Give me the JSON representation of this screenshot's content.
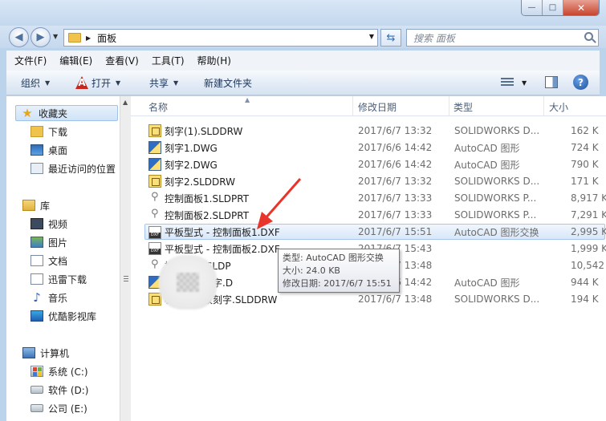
{
  "window": {
    "ghost_title": "",
    "buttons": {
      "minimize": "—",
      "maximize": "□",
      "close": "✕"
    }
  },
  "nav": {
    "address": "面板",
    "search_placeholder": "搜索 面板"
  },
  "menu": [
    "文件(F)",
    "编辑(E)",
    "查看(V)",
    "工具(T)",
    "帮助(H)"
  ],
  "toolbar": {
    "organize": "组织",
    "open": "打开",
    "share": "共享",
    "new_folder": "新建文件夹"
  },
  "sidebar": {
    "favorites": "收藏夹",
    "fav_items": [
      "下载",
      "桌面",
      "最近访问的位置"
    ],
    "libraries": "库",
    "lib_items": [
      "视频",
      "图片",
      "文档",
      "迅雷下载",
      "音乐",
      "优酷影视库"
    ],
    "computer": "计算机",
    "drives": [
      "系统 (C:)",
      "软件 (D:)",
      "公司 (E:)"
    ]
  },
  "columns": {
    "name": "名称",
    "date": "修改日期",
    "type": "类型",
    "size": "大小"
  },
  "files": [
    {
      "name": "刻字(1).SLDDRW",
      "date": "2017/6/7 13:32",
      "type": "SOLIDWORKS D...",
      "size": "162 K",
      "icon": "slddrw"
    },
    {
      "name": "刻字1.DWG",
      "date": "2017/6/6 14:42",
      "type": "AutoCAD 图形",
      "size": "724 K",
      "icon": "dwg"
    },
    {
      "name": "刻字2.DWG",
      "date": "2017/6/6 14:42",
      "type": "AutoCAD 图形",
      "size": "790 K",
      "icon": "dwg"
    },
    {
      "name": "刻字2.SLDDRW",
      "date": "2017/6/7 13:32",
      "type": "SOLIDWORKS D...",
      "size": "171 K",
      "icon": "slddrw"
    },
    {
      "name": "控制面板1.SLDPRT",
      "date": "2017/6/7 13:33",
      "type": "SOLIDWORKS P...",
      "size": "8,917 K",
      "icon": "sldprt"
    },
    {
      "name": "控制面板2.SLDPRT",
      "date": "2017/6/7 13:33",
      "type": "SOLIDWORKS P...",
      "size": "7,291 K",
      "icon": "sldprt"
    },
    {
      "name": "平板型式 - 控制面板1.DXF",
      "date": "2017/6/7 15:51",
      "type": "AutoCAD 图形交换",
      "size": "2,995 K",
      "icon": "dxf",
      "selected": true
    },
    {
      "name": "平板型式 - 控制面板2.DXF",
      "date": "2017/6/7 15:43",
      "type": "",
      "size": "1,999 K",
      "icon": "dxf"
    },
    {
      "name": "操作面板.SLDP",
      "date": "2017/6/7 13:48",
      "type": "",
      "size": "10,542 K",
      "icon": "sldprt"
    },
    {
      "name": "操作面板刻字.D",
      "date": "2017/6/6 14:42",
      "type": "AutoCAD 图形",
      "size": "944 K",
      "icon": "dwg"
    },
    {
      "name": "机操作面板刻字.SLDDRW",
      "date": "2017/6/7 13:48",
      "type": "SOLIDWORKS D...",
      "size": "194 K",
      "icon": "slddrw"
    }
  ],
  "tooltip": {
    "type": "类型: AutoCAD 图形交换",
    "size": "大小: 24.0 KB",
    "date": "修改日期: 2017/6/7 15:51"
  },
  "colors": {
    "annotation_arrow": "#e8342a",
    "selection": "#d8e7f9"
  }
}
